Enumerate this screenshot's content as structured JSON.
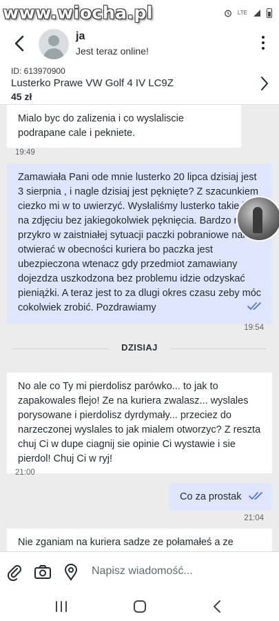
{
  "watermark": "www.wiocha.pl",
  "status_bar": {
    "network": "LTE"
  },
  "header": {
    "name": "ja",
    "status": "Jest teraz online!",
    "icons": [
      "back-arrow-icon",
      "avatar-placeholder",
      "more-vert-icon"
    ]
  },
  "ad": {
    "id": "ID: 613970900",
    "title": "Lusterko Prawe VW Golf 4 IV LC9Z",
    "price": "45 zł"
  },
  "messages": [
    {
      "direction": "in",
      "text": "Mialo byc do zalizenia i co wyslaliscie podrapane cale i pekniete.",
      "time": "19:49"
    },
    {
      "direction": "out",
      "text": "Zamawiała Pani ode mnie lusterko 20 lipca dzisiaj jest 3 sierpnia , i nagle dzisiaj jest pęknięte? Z szacunkiem ciezko mi w to uwierzyć. Wysłaliśmy lusterko takie jak na zdjęciu bez jakiegokolwiek pęknięcia. Bardzo mi przykro w zaistniałej sytuacji paczki pobraniowe należy otwierać w obecności kuriera bo paczka jest ubezpieczona wtenacz gdy przedmiot zamawiany dojezdza uszkodzona bez problemu idzie odzyskać pieniążki. A teraz jest to za dlugi okres czasu zeby móc cokolwiek zrobić. Pozdrawiamy",
      "time": "19:54",
      "read": true
    },
    {
      "direction": "in",
      "text": "No ale co Ty mi pierdolisz parówko... to jak to zapakowales flejo! Ze na kuriera zwalasz... wyslales porysowane i pierdolisz dyrdymały... przeciez do narzeczonej wyslales to jak mialem otworzyc? Z reszta chuj Ci w dupe ciagnij sie opinie Ci wystawie i sie pierdol! Chuj Ci w ryj!",
      "time": "21:00"
    },
    {
      "direction": "out",
      "text": "Co za prostak",
      "time": "21:04",
      "read": true
    },
    {
      "direction": "in",
      "text": "Nie zganiam na kuriera sadze ze połamałeś a ze"
    }
  ],
  "day_separator": "DZISIAJ",
  "composer": {
    "placeholder": "Napisz wiadomość...",
    "icons": [
      "attach-icon",
      "camera-icon",
      "location-icon"
    ]
  },
  "nav_bar": {
    "icons": [
      "recents-icon",
      "home-icon",
      "back-icon"
    ]
  },
  "colors": {
    "incoming_bubble": "#ffffff",
    "outgoing_bubble": "#dfe6fb",
    "chat_background": "#ececec",
    "read_ticks": "#3a6ee8"
  }
}
